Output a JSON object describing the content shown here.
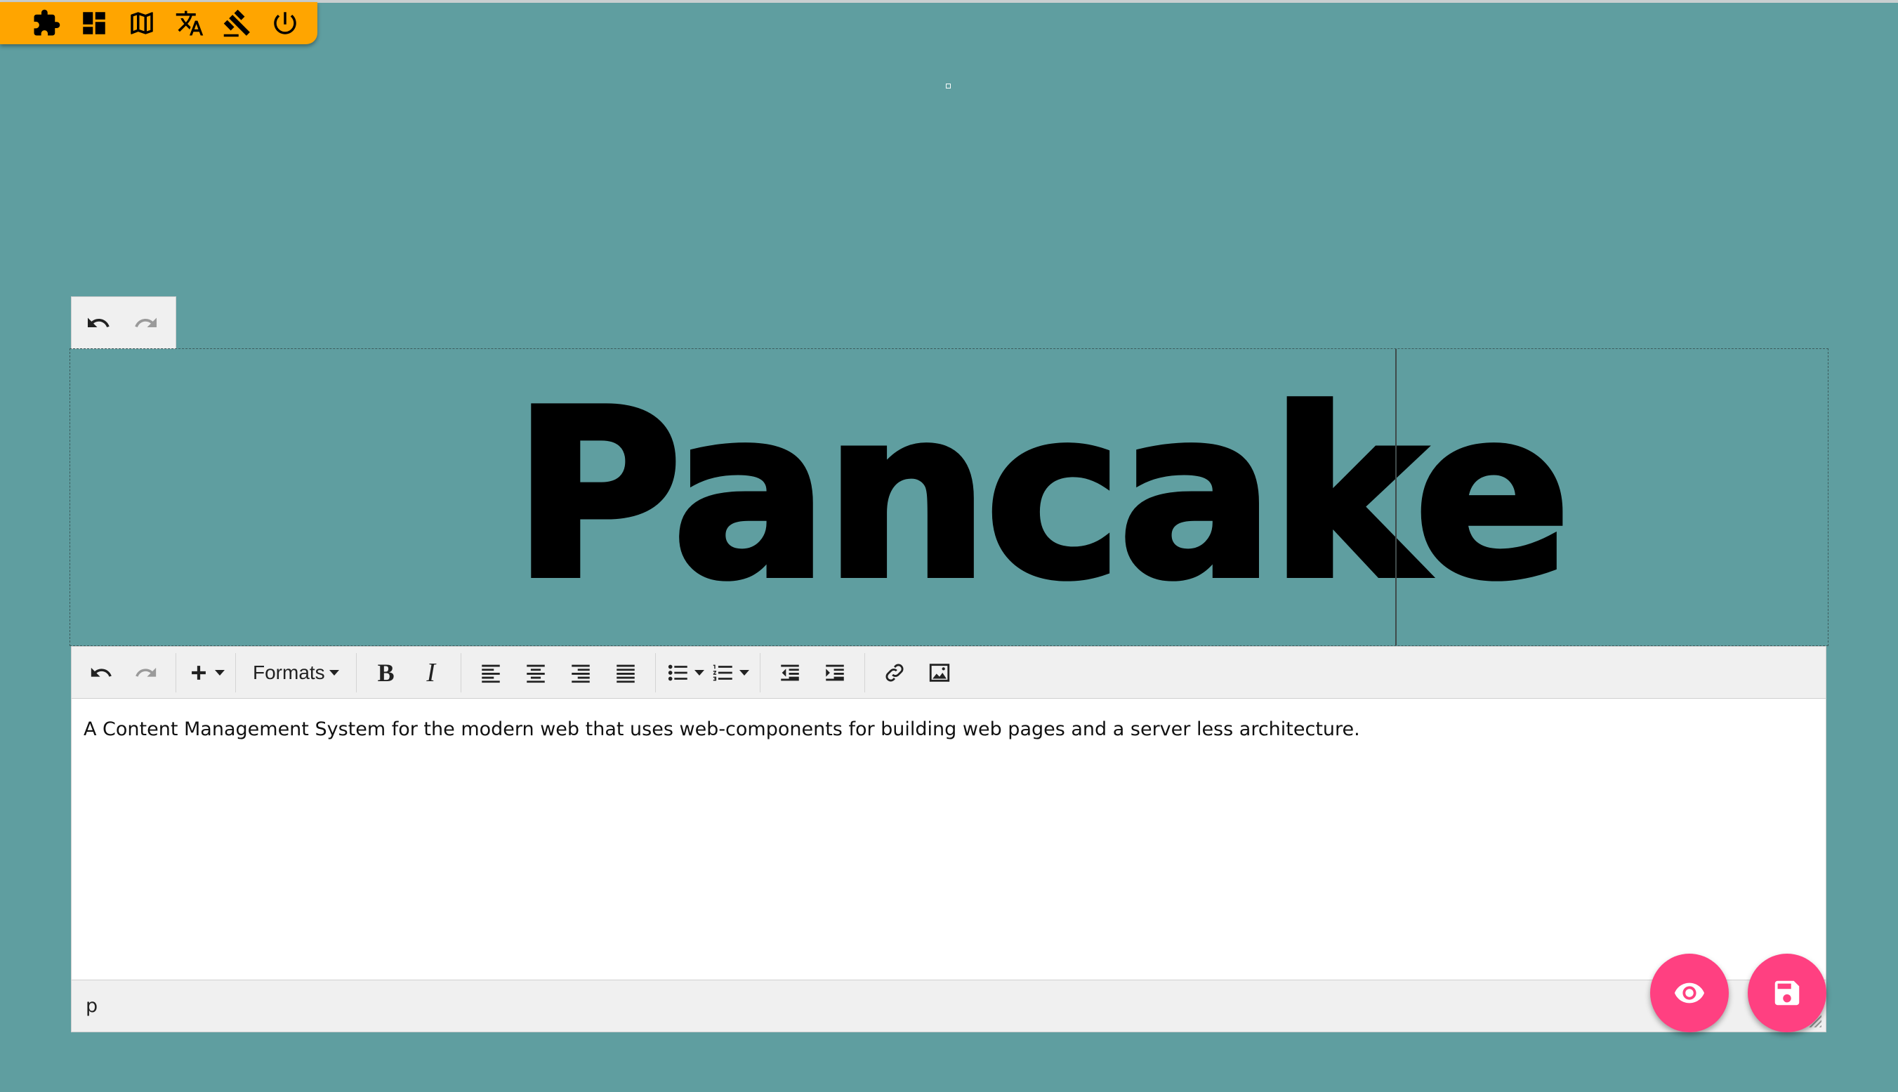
{
  "topbar": {
    "icons": [
      "puzzle-icon",
      "dashboard-icon",
      "map-icon",
      "translate-icon",
      "gavel-icon",
      "power-icon"
    ],
    "accent_color": "#ffa500"
  },
  "background_color": "#5f9ea0",
  "title": {
    "text": "Pancake"
  },
  "mini_toolbar": {
    "icons": [
      "undo-icon",
      "redo-icon"
    ]
  },
  "editor": {
    "toolbar": {
      "formats_label": "Formats",
      "bold_label": "B",
      "italic_label": "I",
      "icons": [
        "undo-icon",
        "redo-icon",
        "insert-plus-icon",
        "align-left-icon",
        "align-center-icon",
        "align-right-icon",
        "align-justify-icon",
        "bullet-list-icon",
        "numbered-list-icon",
        "outdent-icon",
        "indent-icon",
        "link-icon",
        "image-icon"
      ]
    },
    "content": "A Content Management System for the modern web that uses web-components for building web pages and a server less architecture.",
    "status_path": "p"
  },
  "fabs": {
    "preview_icon": "eye-icon",
    "save_icon": "save-icon",
    "color": "#ff4081"
  }
}
